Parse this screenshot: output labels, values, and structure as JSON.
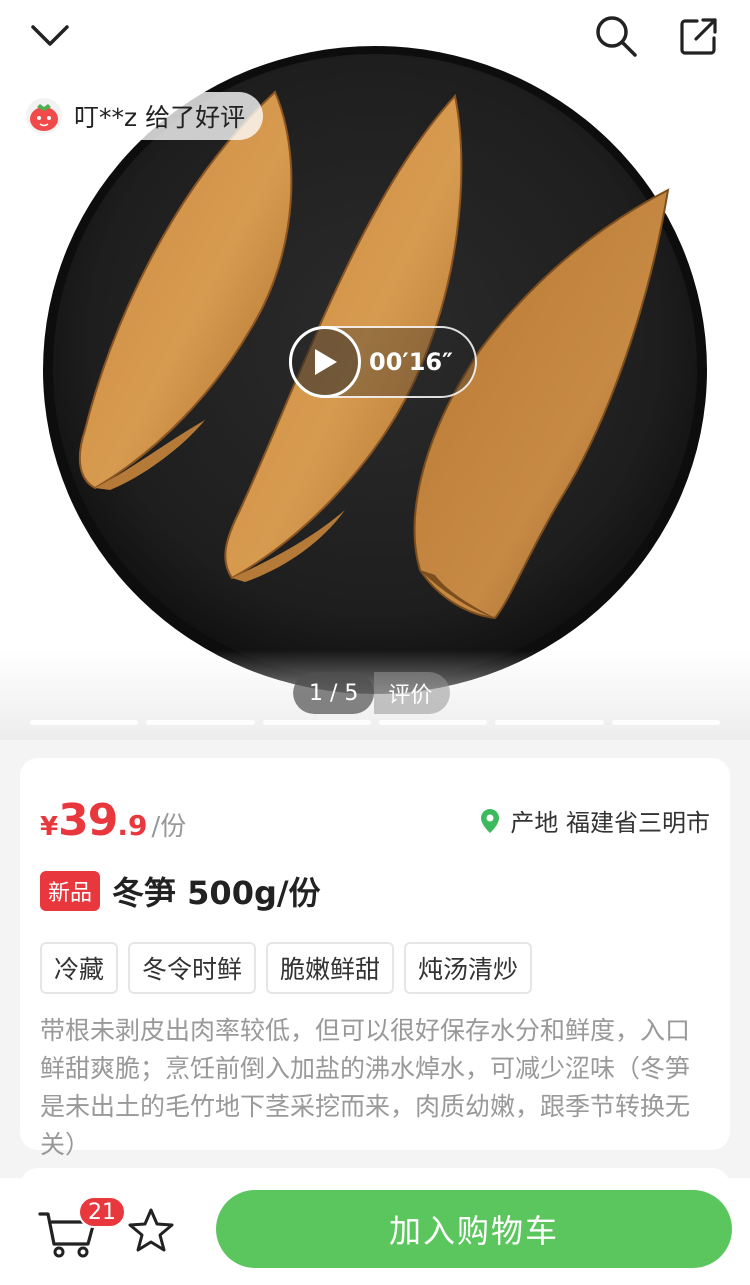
{
  "header": {
    "back_icon": "chevron-down-icon",
    "search_icon": "search-icon",
    "share_icon": "share-icon"
  },
  "media": {
    "review_text": "叮**z 给了好评",
    "video_duration": "00′16″",
    "page_indicator": "1 / 5",
    "review_tab": "评价",
    "total_segments": 6,
    "active_segment": 1
  },
  "product": {
    "price_symbol": "¥",
    "price_integer": "39",
    "price_decimal": ".9",
    "price_unit": "/份",
    "origin_label": "产地 福建省三明市",
    "badge": "新品",
    "title": "冬笋 500g/份",
    "tags": [
      "冷藏",
      "冬令时鲜",
      "脆嫩鲜甜",
      "炖汤清炒"
    ],
    "description": "带根未剥皮出肉率较低，但可以很好保存水分和鲜度，入口鲜甜爽脆；烹饪前倒入加盐的沸水焯水，可减少涩味（冬笋是未出土的毛竹地下茎采挖而来，肉质幼嫩，跟季节转换无关）"
  },
  "bottom_bar": {
    "cart_count": "21",
    "add_to_cart": "加入购物车"
  },
  "colors": {
    "accent_red": "#e8383d",
    "brand_green": "#5cc65e",
    "location_green": "#3dbb5c"
  }
}
